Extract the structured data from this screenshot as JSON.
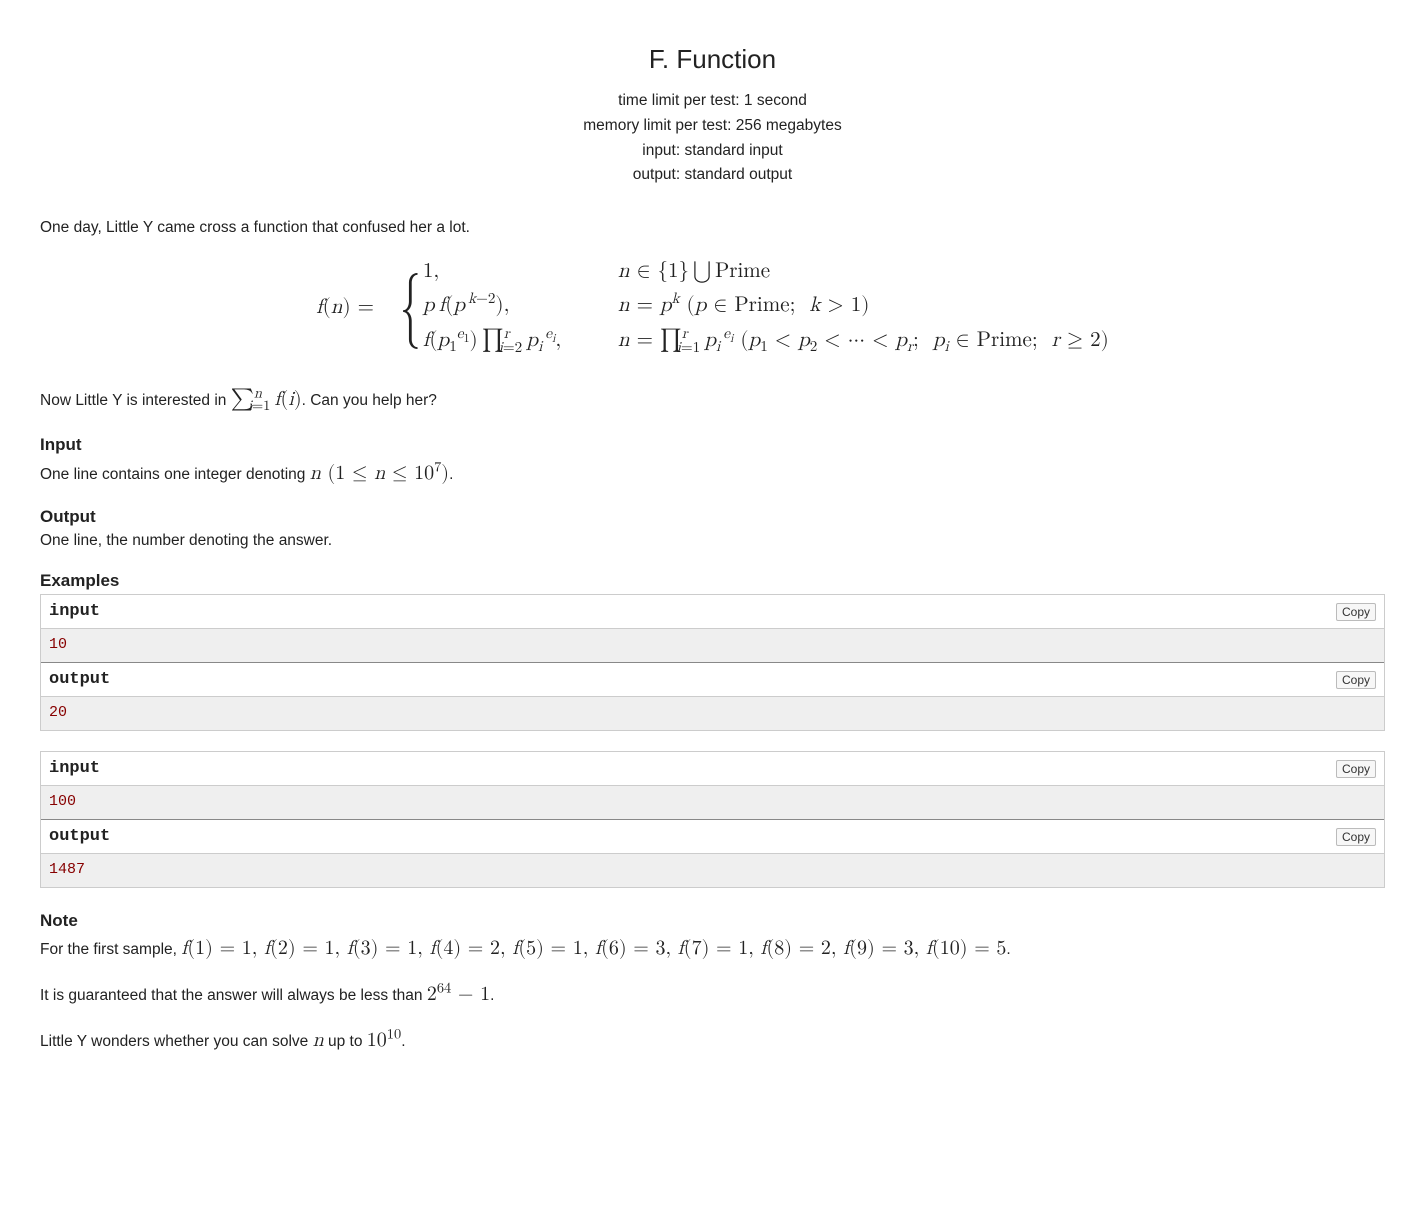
{
  "title": "F. Function",
  "limits": {
    "time_label": "time limit per test:",
    "time_value": "1 second",
    "memory_label": "memory limit per test:",
    "memory_value": "256 megabytes",
    "input_label": "input:",
    "input_value": "standard input",
    "output_label": "output:",
    "output_value": "standard output"
  },
  "intro": "One day, Little Y came cross a function that confused her a lot.",
  "after_formula_prefix": "Now Little Y is interested in ",
  "after_formula_suffix": ". Can you help her?",
  "sections": {
    "input_title": "Input",
    "input_text_prefix": "One line contains one integer denoting ",
    "input_text_suffix": ".",
    "output_title": "Output",
    "output_text": "One line, the number denoting the answer.",
    "examples_title": "Examples",
    "note_title": "Note"
  },
  "io_labels": {
    "input": "input",
    "output": "output",
    "copy": "Copy"
  },
  "examples": [
    {
      "input": "10",
      "output": "20"
    },
    {
      "input": "100",
      "output": "1487"
    }
  ],
  "note": {
    "sample_prefix": "For the first sample, ",
    "sample_suffix": ".",
    "f_values": [
      {
        "arg": "1",
        "val": "1"
      },
      {
        "arg": "2",
        "val": "1"
      },
      {
        "arg": "3",
        "val": "1"
      },
      {
        "arg": "4",
        "val": "2"
      },
      {
        "arg": "5",
        "val": "1"
      },
      {
        "arg": "6",
        "val": "3"
      },
      {
        "arg": "7",
        "val": "1"
      },
      {
        "arg": "8",
        "val": "2"
      },
      {
        "arg": "9",
        "val": "3"
      },
      {
        "arg": "10",
        "val": "5"
      }
    ],
    "guarantee_prefix": "It is guaranteed that the answer will always be less than ",
    "guarantee_suffix": ".",
    "wonder_prefix": "Little Y wonders whether you can solve ",
    "wonder_mid": " up to ",
    "wonder_suffix": "."
  }
}
